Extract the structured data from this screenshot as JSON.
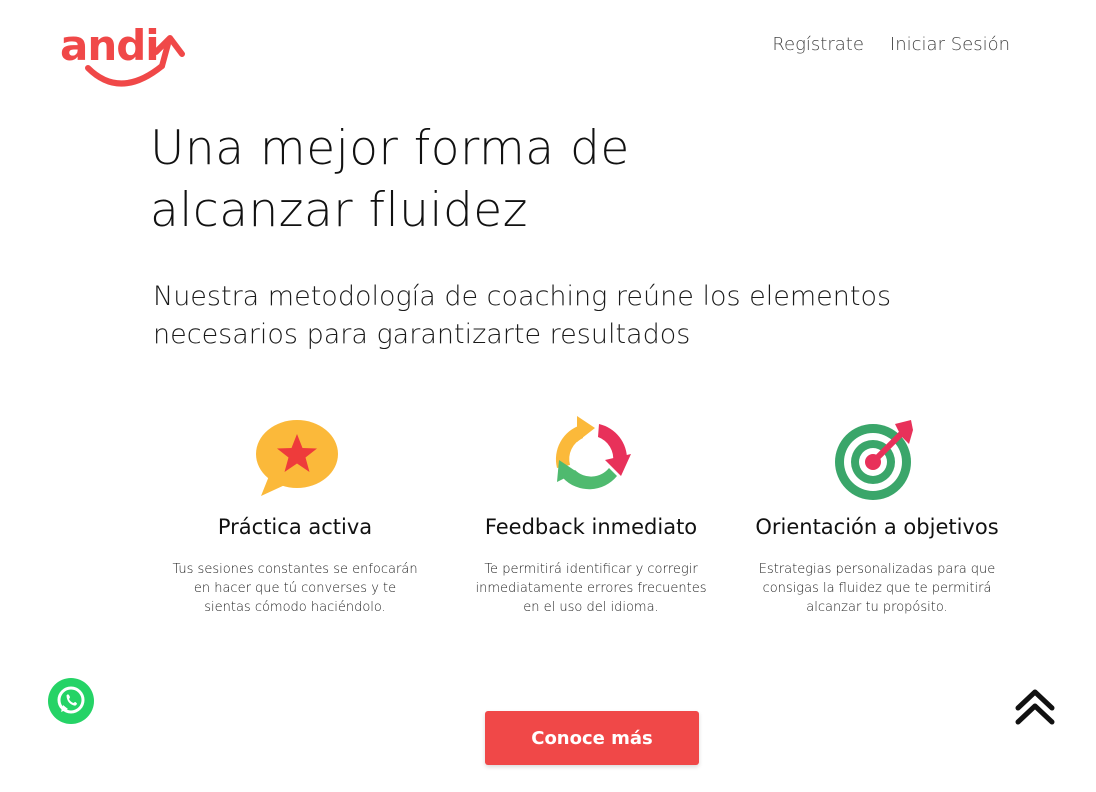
{
  "header": {
    "logo_text": "andi",
    "nav": [
      {
        "label": "Regístrate"
      },
      {
        "label": "Iniciar Sesión"
      }
    ]
  },
  "hero": {
    "title_line1": "Una mejor forma de",
    "title_line2": "alcanzar fluidez",
    "subtitle_line1": "Nuestra metodología de coaching reúne los elementos",
    "subtitle_line2": "necesarios para garantizarte resultados"
  },
  "features": [
    {
      "icon": "star-speech-bubble-icon",
      "title": "Práctica activa",
      "line1": "Tus sesiones constantes se enfocarán",
      "line2": "en hacer que tú converses y te",
      "line3": "sientas cómodo haciéndolo."
    },
    {
      "icon": "cycle-arrows-icon",
      "title": "Feedback inmediato",
      "line1": "Te permitirá identificar y corregir",
      "line2": "inmediatamente errores frecuentes",
      "line3": "en el uso del idioma."
    },
    {
      "icon": "target-dart-icon",
      "title": "Orientación a objetivos",
      "line1": "Estrategias personalizadas para que",
      "line2": "consigas la fluidez que te permitirá",
      "line3": "alcanzar tu propósito."
    }
  ],
  "cta": {
    "label": "Conoce más"
  },
  "floating": {
    "whatsapp_icon": "whatsapp-icon",
    "scroll_top_icon": "double-chevron-up-icon"
  },
  "colors": {
    "brand_red": "#f04848",
    "star_yellow": "#fbb93a",
    "cycle_red": "#e8315a",
    "cycle_green": "#4fba6f",
    "target_green": "#3aa66a",
    "whatsapp_green": "#25d366"
  }
}
